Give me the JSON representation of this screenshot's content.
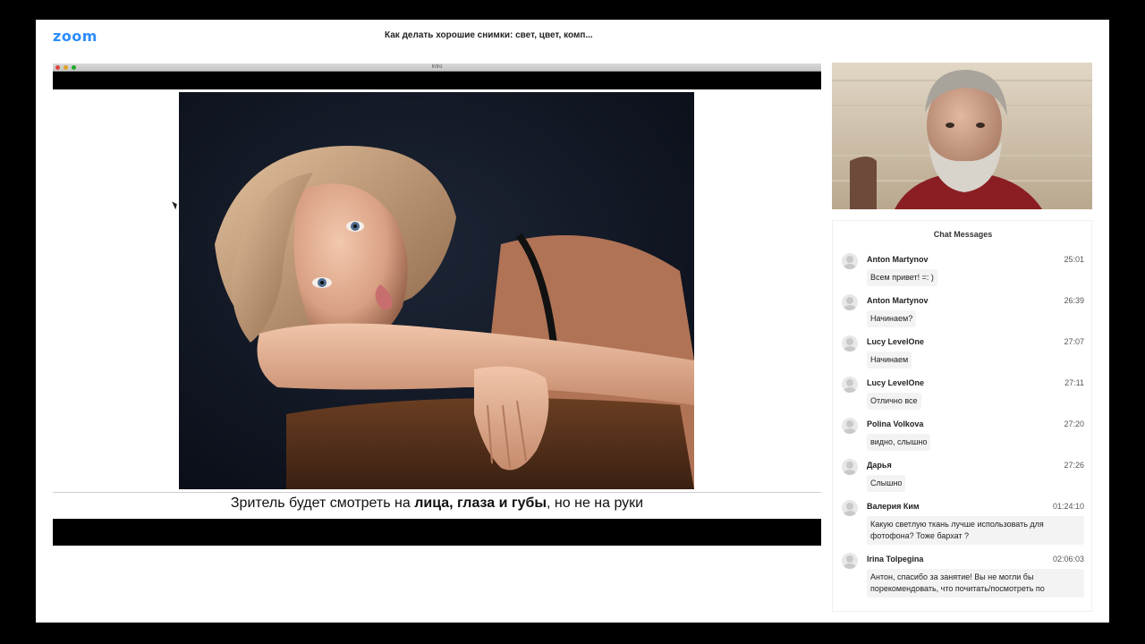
{
  "app": {
    "logo": "zoom",
    "meeting_title": "Как делать хорошие снимки: свет, цвет, комп..."
  },
  "share": {
    "window_title": "Intro",
    "caption_before": "Зритель будет смотреть на ",
    "caption_bold": "лица, глаза и губы",
    "caption_after": ", но не на руки"
  },
  "chat": {
    "title": "Chat Messages",
    "messages": [
      {
        "name": "Anton Martynov",
        "time": "25:01",
        "text": "Всем привет! =: )"
      },
      {
        "name": "Anton Martynov",
        "time": "26:39",
        "text": "Начинаем?"
      },
      {
        "name": "Lucy LevelOne",
        "time": "27:07",
        "text": "Начинаем"
      },
      {
        "name": "Lucy LevelOne",
        "time": "27:11",
        "text": "Отлично все"
      },
      {
        "name": "Polina Volkova",
        "time": "27:20",
        "text": "видно, слышно"
      },
      {
        "name": "Дарья",
        "time": "27:26",
        "text": "Слышно"
      },
      {
        "name": "Валерия Ким",
        "time": "01:24:10",
        "text": "Какую светлую ткань лучше использовать для фотофона? Тоже бархат ?"
      },
      {
        "name": "Irina Tolpegina",
        "time": "02:06:03",
        "text": "Антон, спасибо за занятие! Вы не могли бы порекомендовать, что почитать/посмотреть по"
      }
    ]
  },
  "colors": {
    "brand": "#2d8cff",
    "share_background": "#000000",
    "chat_bubble": "#f3f3f3"
  }
}
